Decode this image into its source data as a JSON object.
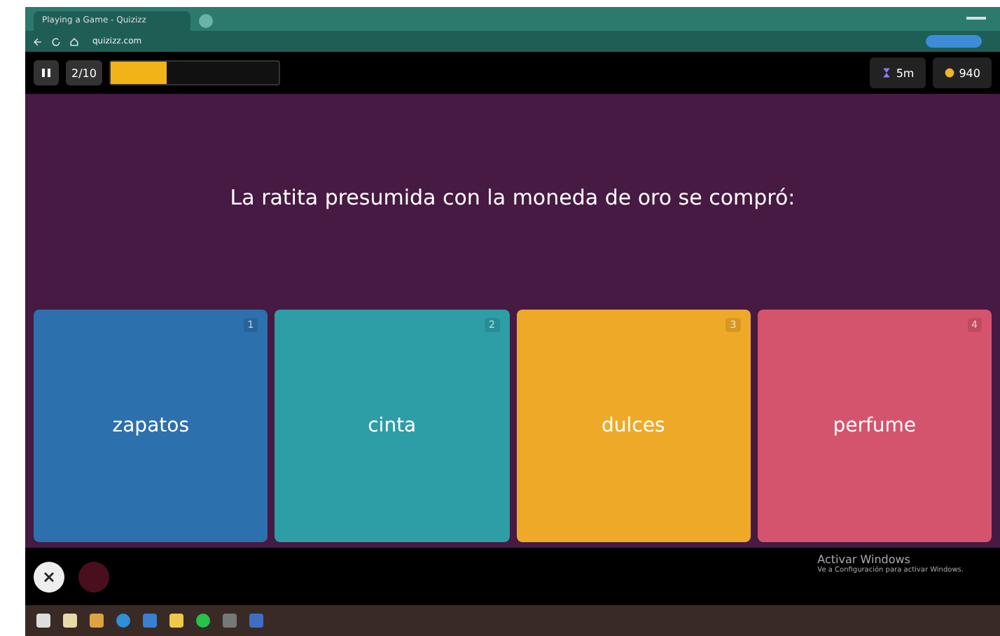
{
  "browser": {
    "tab_title": "Playing a Game - Quizizz",
    "url": "quizizz.com"
  },
  "quiz": {
    "question_counter": "2/10",
    "progress": {
      "level": 0.33
    },
    "timer": "5m",
    "score": "940",
    "question": "La ratita presumida con la moneda de oro se compró:",
    "options": [
      {
        "number": "1",
        "text": "zapatos",
        "color": "#2d70ae"
      },
      {
        "number": "2",
        "text": "cinta",
        "color": "#2d9da6"
      },
      {
        "number": "3",
        "text": "dulces",
        "color": "#efa929"
      },
      {
        "number": "4",
        "text": "perfume",
        "color": "#d5546d"
      }
    ]
  },
  "activation": {
    "title": "Activar Windows",
    "subtitle": "Ve a Configuración para activar Windows."
  }
}
